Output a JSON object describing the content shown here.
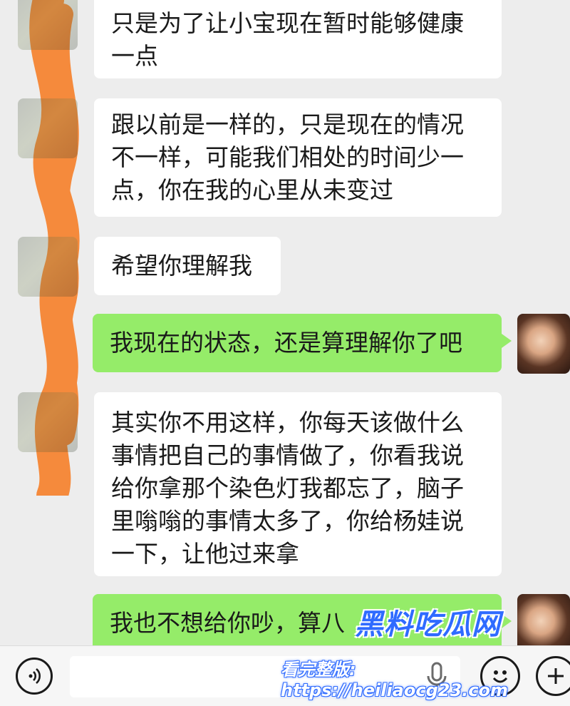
{
  "messages": [
    {
      "side": "left",
      "text": "只是为了让小宝现在暂时能够健康一点"
    },
    {
      "side": "left",
      "text": "跟以前是一样的，只是现在的情况不一样，可能我们相处的时间少一点，你在我的心里从未变过"
    },
    {
      "side": "left",
      "text": "希望你理解我"
    },
    {
      "side": "right",
      "text": "我现在的状态，还是算理解你了吧"
    },
    {
      "side": "left",
      "text": "其实你不用这样，你每天该做什么事情把自己的事情做了，你看我说给你拿那个染色灯我都忘了，脑子里嗡嗡的事情太多了，你给杨娃说一下，让他过来拿"
    },
    {
      "side": "right",
      "text": "我也不想给你吵，算八"
    }
  ],
  "watermark": {
    "title": "黑料吃瓜网",
    "url": "看完整版: https://heiliaocg23.com"
  },
  "input_bar": {
    "voice_icon": "voice-icon",
    "mic_icon": "mic-icon",
    "emoji_icon": "emoji-icon",
    "plus_icon": "plus-icon"
  },
  "colors": {
    "background": "#ededed",
    "incoming_bubble": "#ffffff",
    "outgoing_bubble": "#95ec69",
    "redaction": "#f58a3c",
    "watermark": "#2f6bff"
  }
}
